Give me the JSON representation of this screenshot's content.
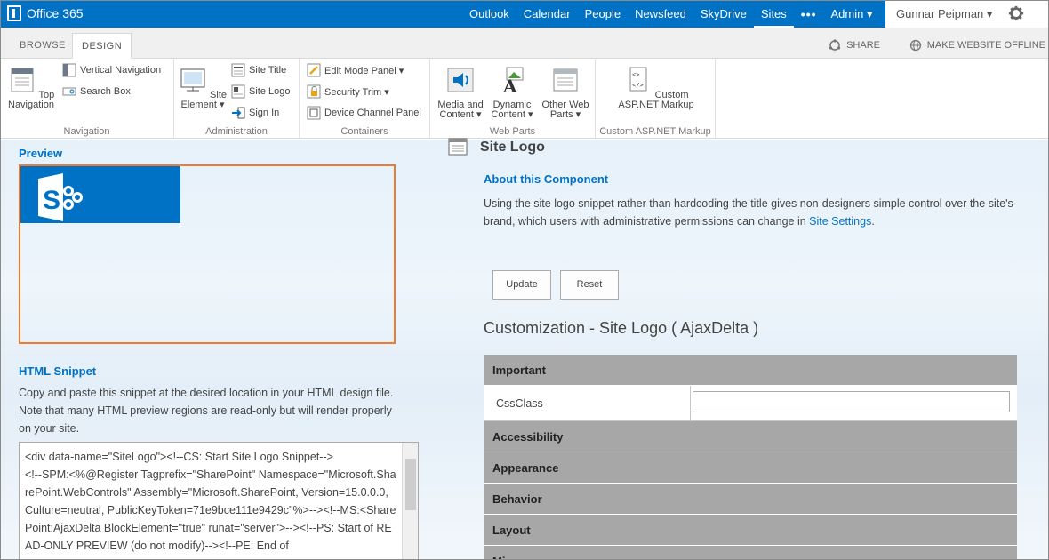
{
  "suite": {
    "brand": "Office 365",
    "nav": [
      "Outlook",
      "Calendar",
      "People",
      "Newsfeed",
      "SkyDrive",
      "Sites"
    ],
    "active_nav": "Sites",
    "more": "•••",
    "admin": "Admin ▾",
    "user": "Gunnar Peipman ▾"
  },
  "ribbon_tabs": {
    "browse": "BROWSE",
    "design": "DESIGN",
    "share": "SHARE",
    "offline": "MAKE WEBSITE OFFLINE"
  },
  "ribbon": {
    "navigation": {
      "label": "Navigation",
      "top_nav": "Top Navigation",
      "vertical_nav": "Vertical Navigation",
      "search_box": "Search Box"
    },
    "administration": {
      "label": "Administration",
      "site_element": "Site Element ▾",
      "site_title": "Site Title",
      "site_logo": "Site Logo",
      "sign_in": "Sign In"
    },
    "containers": {
      "label": "Containers",
      "edit_mode_panel": "Edit Mode Panel ▾",
      "security_trim": "Security Trim ▾",
      "device_channel_panel": "Device Channel Panel"
    },
    "web_parts": {
      "label": "Web Parts",
      "media_content": "Media and Content ▾",
      "dynamic_content": "Dynamic Content ▾",
      "other_web_parts": "Other Web Parts ▾"
    },
    "custom_markup": {
      "label": "Custom ASP.NET Markup",
      "button": "Custom ASP.NET Markup"
    }
  },
  "preview": {
    "label": "Preview"
  },
  "snippet": {
    "title": "HTML Snippet",
    "description": "Copy and paste this snippet at the desired location in your HTML design file. Note that many HTML preview regions are read-only but will render properly on your site.",
    "code": "<div data-name=\"SiteLogo\"><!--CS: Start Site Logo Snippet-->\n<!--SPM:<%@Register Tagprefix=\"SharePoint\" Namespace=\"Microsoft.SharePoint.WebControls\" Assembly=\"Microsoft.SharePoint, Version=15.0.0.0, Culture=neutral, PublicKeyToken=71e9bce111e9429c\"%>--><!--MS:<SharePoint:AjaxDelta BlockElement=\"true\" runat=\"server\">--><!--PS: Start of READ-ONLY PREVIEW (do not modify)--><!--PE: End of"
  },
  "component": {
    "title": "Site Logo",
    "about_title": "About this Component",
    "about_text": "Using the site logo snippet rather than hardcoding the title gives non-designers simple control over the site's brand, which users with administrative permissions can change in ",
    "about_link": "Site Settings",
    "about_end": ".",
    "update": "Update",
    "reset": "Reset",
    "customization_title": "Customization - Site Logo ( AjaxDelta )"
  },
  "properties": {
    "important": "Important",
    "css_class_label": "CssClass",
    "css_class_value": "",
    "sections": [
      "Accessibility",
      "Appearance",
      "Behavior",
      "Layout",
      "Misc"
    ]
  },
  "colors": {
    "suitebar": "#0072c6",
    "accent_text": "#0072c6",
    "preview_border": "#f07b2d",
    "property_header": "#a7a7a7"
  }
}
